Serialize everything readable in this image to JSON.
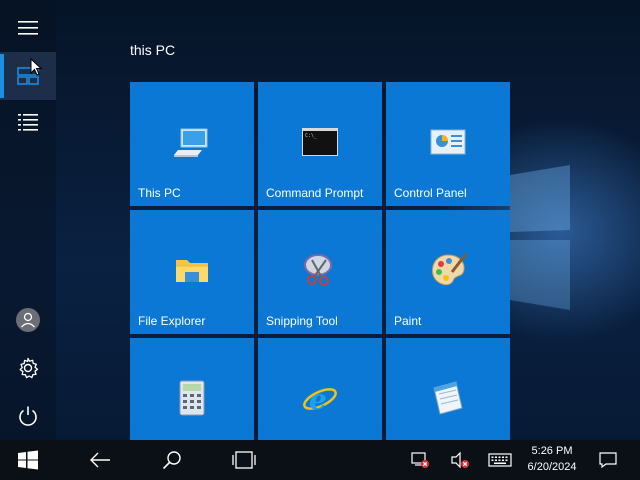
{
  "start": {
    "group_title": "this PC",
    "tiles": [
      {
        "label": "This PC",
        "icon": "this-pc-icon"
      },
      {
        "label": "Command Prompt",
        "icon": "command-prompt-icon"
      },
      {
        "label": "Control Panel",
        "icon": "control-panel-icon"
      },
      {
        "label": "File Explorer",
        "icon": "file-explorer-icon"
      },
      {
        "label": "Snipping Tool",
        "icon": "snipping-tool-icon"
      },
      {
        "label": "Paint",
        "icon": "paint-icon"
      },
      {
        "label": "",
        "icon": "calculator-icon"
      },
      {
        "label": "",
        "icon": "internet-explorer-icon"
      },
      {
        "label": "",
        "icon": "notepad-icon"
      }
    ]
  },
  "rail": {
    "items": [
      "hamburger-menu-icon",
      "tiles-view-icon",
      "all-apps-list-icon",
      "user-account-icon",
      "settings-gear-icon",
      "power-icon"
    ]
  },
  "taskbar": {
    "time": "5:26 PM",
    "date": "6/20/2024"
  },
  "colors": {
    "tile": "#0a78d4",
    "accent": "#1a8fe8",
    "taskbar": "#0b0f16"
  }
}
